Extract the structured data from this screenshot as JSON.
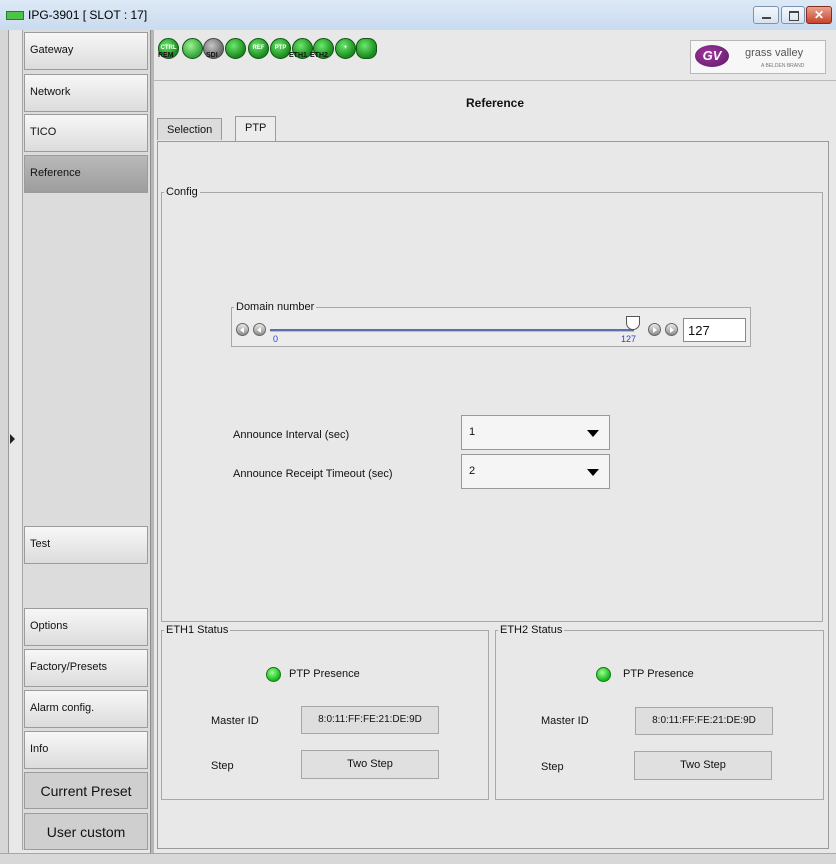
{
  "window": {
    "title": "IPG-3901 [ SLOT : 17]"
  },
  "sidebar": {
    "items": [
      {
        "label": "Gateway"
      },
      {
        "label": "Network"
      },
      {
        "label": "TICO"
      },
      {
        "label": "Reference",
        "active": true
      },
      {
        "label": "Test"
      },
      {
        "label": "Options"
      },
      {
        "label": "Factory/Presets"
      },
      {
        "label": "Alarm config."
      },
      {
        "label": "Info"
      }
    ],
    "current_preset": "Current Preset",
    "user_custom": "User custom"
  },
  "status_icons": {
    "labels": [
      "CTRL",
      "REF",
      "PTP"
    ],
    "captions": [
      "REM",
      "SDI",
      "ETH1",
      "ETH2"
    ]
  },
  "logo": {
    "name": "grass valley",
    "sub": "A BELDEN BRAND"
  },
  "page": {
    "title": "Reference",
    "tabs": [
      {
        "label": "Selection"
      },
      {
        "label": "PTP",
        "active": true
      }
    ]
  },
  "config": {
    "legend": "Config",
    "domain": {
      "legend": "Domain number",
      "min_label": "0",
      "value_label": "127",
      "input_value": "127",
      "value": 127,
      "min": 0,
      "max": 127
    },
    "announce_interval": {
      "label": "Announce Interval (sec)",
      "value": "1"
    },
    "announce_timeout": {
      "label": "Announce Receipt Timeout (sec)",
      "value": "2"
    }
  },
  "eth1": {
    "legend": "ETH1 Status",
    "presence": "PTP Presence",
    "master_id_label": "Master ID",
    "master_id": "8:0:11:FF:FE:21:DE:9D",
    "step_label": "Step",
    "step": "Two Step"
  },
  "eth2": {
    "legend": "ETH2 Status",
    "presence": "PTP Presence",
    "master_id_label": "Master ID",
    "master_id": "8:0:11:FF:FE:21:DE:9D",
    "step_label": "Step",
    "step": "Two Step"
  },
  "colors": {
    "led_green": "#14b71a",
    "slider_blue": "#2b3fcc",
    "active_nav": "#a9a9a9"
  }
}
